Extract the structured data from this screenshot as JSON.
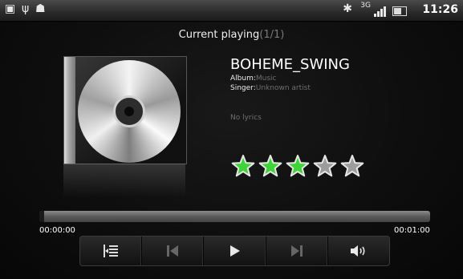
{
  "status_bar": {
    "time": "11:26",
    "network": "3G",
    "icons": [
      "sim-icon",
      "usb-icon",
      "android-debug-icon",
      "bluetooth-icon",
      "signal-icon",
      "battery-icon"
    ]
  },
  "player": {
    "header_label": "Current playing",
    "header_count": "(1/1)",
    "song_title": "BOHEME_SWING",
    "album_label": "Album:",
    "album_value": "Music",
    "singer_label": "Singer:",
    "singer_value": "Unknown artist",
    "lyrics_text": "No lyrics",
    "rating": 3,
    "rating_max": 5,
    "elapsed": "00:00:00",
    "duration": "00:01:00",
    "progress_fraction": 0.0
  },
  "controls": [
    "playlist-icon",
    "previous-icon",
    "play-icon",
    "next-icon",
    "volume-icon"
  ],
  "colors": {
    "star_on": "#3fd43a",
    "star_off": "#9c9c9c",
    "background": "#0b0b0b",
    "dim_text": "#6f6f6f"
  }
}
